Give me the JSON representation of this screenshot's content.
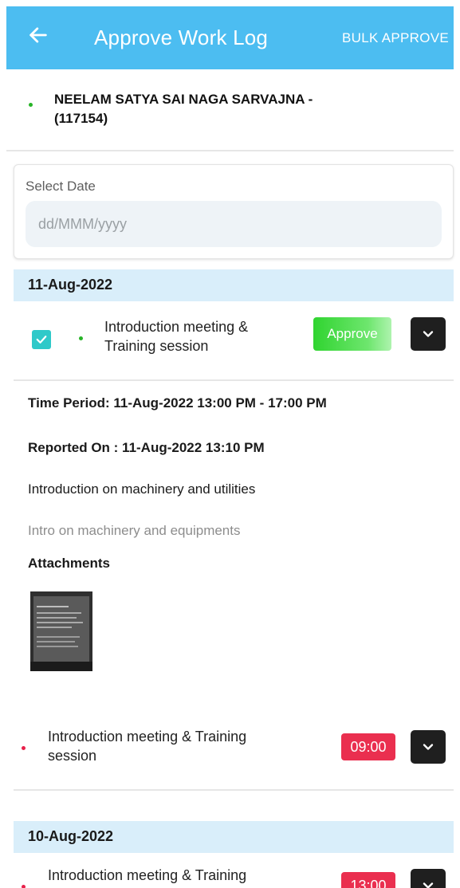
{
  "appbar": {
    "title": "Approve Work Log",
    "bulk_label": "BULK APPROVE"
  },
  "user": {
    "name_line1": "NEELAM SATYA SAI NAGA SARVAJNA -",
    "name_line2": "(117154)"
  },
  "date_filter": {
    "label": "Select Date",
    "placeholder": "dd/MMM/yyyy"
  },
  "groups": [
    {
      "date": "11-Aug-2022",
      "entries": [
        {
          "task_line1": "Introduction meeting &",
          "task_line2": "Training session",
          "action_label": "Approve",
          "time_period": "Time Period: 11-Aug-2022 13:00 PM - 17:00 PM",
          "reported_on": "Reported On : 11-Aug-2022 13:10 PM",
          "description": "Introduction on machinery and utilities",
          "remarks": "Intro on machinery and equipments",
          "attachments_label": "Attachments"
        },
        {
          "task_line1": "Introduction meeting & Training",
          "task_line2": "session",
          "duration": "09:00"
        }
      ]
    },
    {
      "date": "10-Aug-2022",
      "entries": [
        {
          "task_line1": "Introduction meeting & Training",
          "duration": "13:00"
        }
      ]
    }
  ],
  "colors": {
    "appbar": "#4cbdf1",
    "day_header": "#d9eefa",
    "approve": "#30d430",
    "duration_badge": "#ea2f4f",
    "checkbox": "#2fc9c9",
    "dot_green": "#27b427",
    "dot_red": "#e8204a"
  },
  "icons": {
    "back": "arrow-left-icon",
    "expand": "chevron-down-icon",
    "check": "check-icon"
  }
}
